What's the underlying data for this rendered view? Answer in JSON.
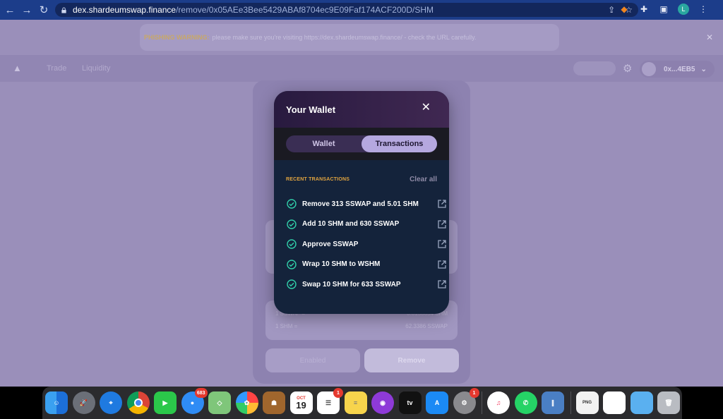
{
  "browser": {
    "url_host": "dex.shardeumswap.finance",
    "url_path": "/remove/0x05AEe3Bee5429ABAf8704ec9E09Faf174ACF200D/SHM",
    "profile_initial": "L"
  },
  "banner": {
    "title": "PHISHING WARNING:",
    "text": "please make sure you're visiting https://dex.shardeumswap.finance/ - check the URL carefully."
  },
  "nav": {
    "links": [
      "Trade",
      "Liquidity"
    ],
    "account": "0x...4EB5"
  },
  "background": {
    "remove_button": "Remove",
    "enable_button": "Enabled",
    "price_rows": [
      {
        "label": "1 SSWAP =",
        "value": "0.0158654 SHM"
      },
      {
        "label": "1 SHM =",
        "value": "62.3386 SSWAP"
      }
    ]
  },
  "modal": {
    "title": "Your Wallet",
    "tabs": [
      {
        "label": "Wallet",
        "active": false
      },
      {
        "label": "Transactions",
        "active": true
      }
    ],
    "recent_label": "RECENT TRANSACTIONS",
    "clear_all": "Clear all",
    "transactions": [
      {
        "label": "Remove 313 SSWAP and 5.01 SHM",
        "status": "success"
      },
      {
        "label": "Add 10 SHM and 630 SSWAP",
        "status": "success"
      },
      {
        "label": "Approve SSWAP",
        "status": "success"
      },
      {
        "label": "Wrap 10 SHM to WSHM",
        "status": "success"
      },
      {
        "label": "Swap 10 SHM for 633 SSWAP",
        "status": "success"
      }
    ]
  },
  "colors": {
    "accent": "#e1a43f",
    "success": "#31d0aa",
    "tab_active": "#b5a8df"
  },
  "dock": {
    "messages_badge": "683",
    "reminders_badge": "1",
    "settings_badge": "1",
    "calendar_month": "OCT",
    "calendar_day": "19"
  }
}
